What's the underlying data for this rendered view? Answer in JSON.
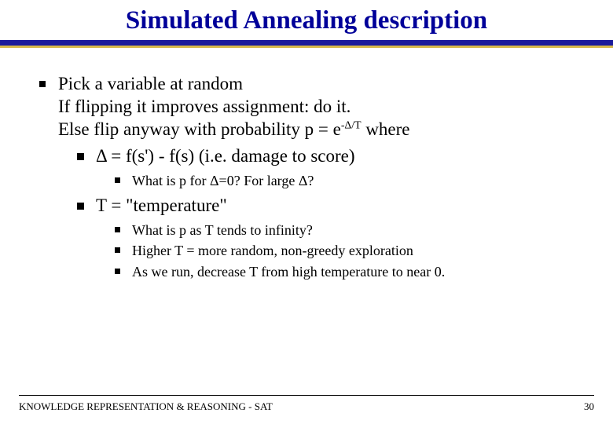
{
  "title": "Simulated Annealing description",
  "bullets": {
    "b1_line1": "Pick a variable at random",
    "b1_line2": "If flipping it improves assignment: do it.",
    "b1_line3_pre": "Else flip anyway with probability p = e",
    "b1_line3_sup": "-Δ/T",
    "b1_line3_post": " where",
    "b2": "Δ = f(s') - f(s) (i.e. damage to score)",
    "b2_sub1": "What is p for Δ=0?  For large Δ?",
    "b3": "T = \"temperature\"",
    "b3_sub1": "What is p as T tends to infinity?",
    "b3_sub2": "Higher T = more random, non-greedy exploration",
    "b3_sub3": "As we run, decrease T from high temperature to near 0."
  },
  "footer": {
    "text": "KNOWLEDGE REPRESENTATION & REASONING - SAT",
    "page": "30"
  }
}
